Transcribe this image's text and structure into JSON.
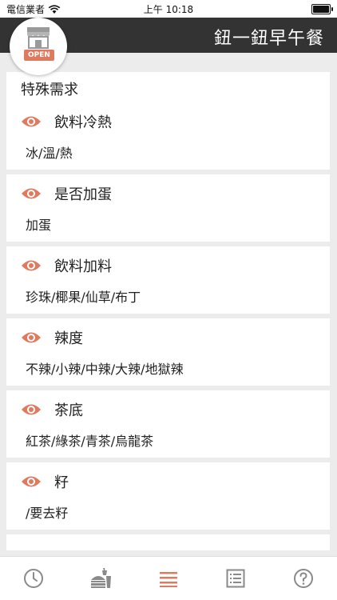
{
  "status": {
    "carrier": "電信業者",
    "time": "上午 10:18",
    "battery_level": 1.0
  },
  "header": {
    "title": "鈕一鈕早午餐",
    "logo_text": "OPEN"
  },
  "section": {
    "title": "特殊需求"
  },
  "options": [
    {
      "label": "飲料冷熱",
      "values": "冰/溫/熱"
    },
    {
      "label": "是否加蛋",
      "values": "加蛋"
    },
    {
      "label": "飲料加料",
      "values": "珍珠/椰果/仙草/布丁"
    },
    {
      "label": "辣度",
      "values": "不辣/小辣/中辣/大辣/地獄辣"
    },
    {
      "label": "茶底",
      "values": "紅茶/綠茶/青茶/烏龍茶"
    },
    {
      "label": "籽",
      "values": "/要去籽"
    }
  ],
  "colors": {
    "accent": "#e07a5f",
    "header_bg": "#333333",
    "icon_gray": "#8a8a8a"
  },
  "tabbar": {
    "tabs": [
      {
        "icon": "clock-icon",
        "active": false
      },
      {
        "icon": "food-drink-icon",
        "active": false
      },
      {
        "icon": "menu-lines-icon",
        "active": true
      },
      {
        "icon": "list-icon",
        "active": false
      },
      {
        "icon": "help-icon",
        "active": false
      }
    ]
  }
}
